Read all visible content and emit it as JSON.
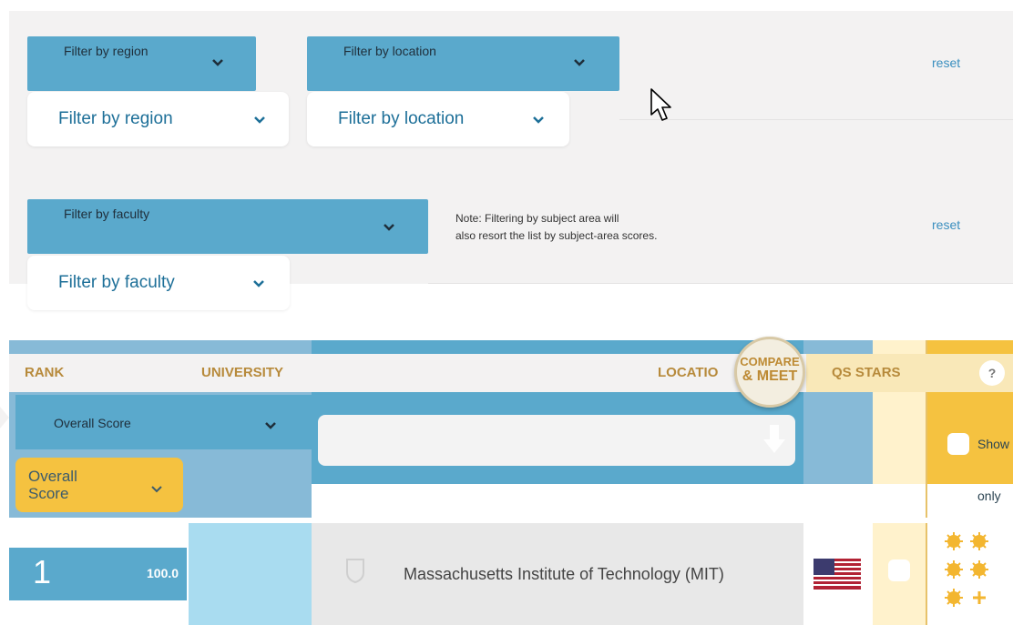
{
  "filters": {
    "region_dropdown_label": "Filter by region",
    "region_value": "Filter by region",
    "location_dropdown_label": "Filter by location",
    "location_value": "Filter by location",
    "faculty_dropdown_label": "Filter by faculty",
    "faculty_value": "Filter by faculty",
    "reset_label": "reset",
    "note_line1": "Note: Filtering by subject area will",
    "note_line2": "also resort the list by subject-area scores."
  },
  "table": {
    "headers": {
      "rank": "RANK",
      "university": "UNIVERSITY",
      "location": "LOCATIO",
      "qs_stars": "QS STARS",
      "help": "?"
    },
    "compare_badge": {
      "line1": "COMPARE",
      "line2": "& MEET"
    },
    "sort": {
      "dropdown_label": "Overall Score",
      "value_line1": "Overall",
      "value_line2": "Score"
    },
    "search_value": "",
    "show_label": "Show",
    "only_label": "only",
    "rows": [
      {
        "rank": "1",
        "score": "100.0",
        "university": "Massachusetts Institute of Technology (MIT)",
        "flag": "us-flag-icon",
        "stars_icon": "qs-star-icon"
      }
    ]
  },
  "colors": {
    "blue": "#5aa9cc",
    "light_blue": "#a9dcf0",
    "gold": "#f5c240",
    "header_text": "#b78a3b",
    "link": "#3a8fbf"
  }
}
